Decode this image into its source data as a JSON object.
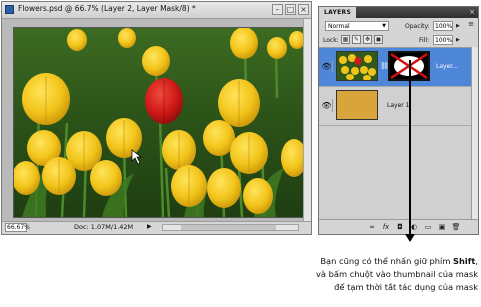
{
  "document": {
    "title": "Flowers.psd @ 66.7% (Layer 2, Layer Mask/8) *",
    "zoom": "66.67%",
    "doc_info": "Doc: 1.07M/1.42M",
    "buttons": {
      "minimize": "–",
      "maximize": "□",
      "close": "×"
    }
  },
  "layers_panel": {
    "tab_label": "LAYERS",
    "close_glyph": "×",
    "menu_glyph": "≡",
    "blend_mode": "Normal",
    "opacity_label": "Opacity:",
    "opacity_value": "100%",
    "lock_label": "Lock:",
    "fill_label": "Fill:",
    "fill_value": "100%",
    "lock_icons": [
      "transparency-lock-icon",
      "paint-lock-icon",
      "move-lock-icon",
      "all-lock-icon"
    ],
    "layers": [
      {
        "name": "Layer...",
        "selected": true,
        "visible": true,
        "has_mask": true
      },
      {
        "name": "Layer 1",
        "selected": false,
        "visible": true,
        "has_mask": false
      }
    ],
    "bottom_icons": [
      "link-icon",
      "fx-icon",
      "mask-icon",
      "adjustment-icon",
      "group-icon",
      "new-layer-icon",
      "trash-icon"
    ],
    "bottom_glyphs": {
      "link": "∞",
      "fx": "fx",
      "mask": "◘",
      "adjustment": "◐",
      "group": "▭",
      "new_layer": "▣",
      "trash": "🗑"
    }
  },
  "caption": {
    "line1_prefix": "Bạn cũng có thể nhấn giữ phím ",
    "line1_bold": "Shift",
    "line1_suffix": ",",
    "line2": "và bấm chuột vào thumbnail của mask",
    "line3": "để tạm thời tắt tác dụng của mask"
  },
  "colors": {
    "selected_layer": "#4e86d8",
    "fill_layer": "#d9a43c",
    "tulip_yellow": "#f2c81a",
    "tulip_red": "#d11c1c",
    "mask_x": "#d11010"
  }
}
